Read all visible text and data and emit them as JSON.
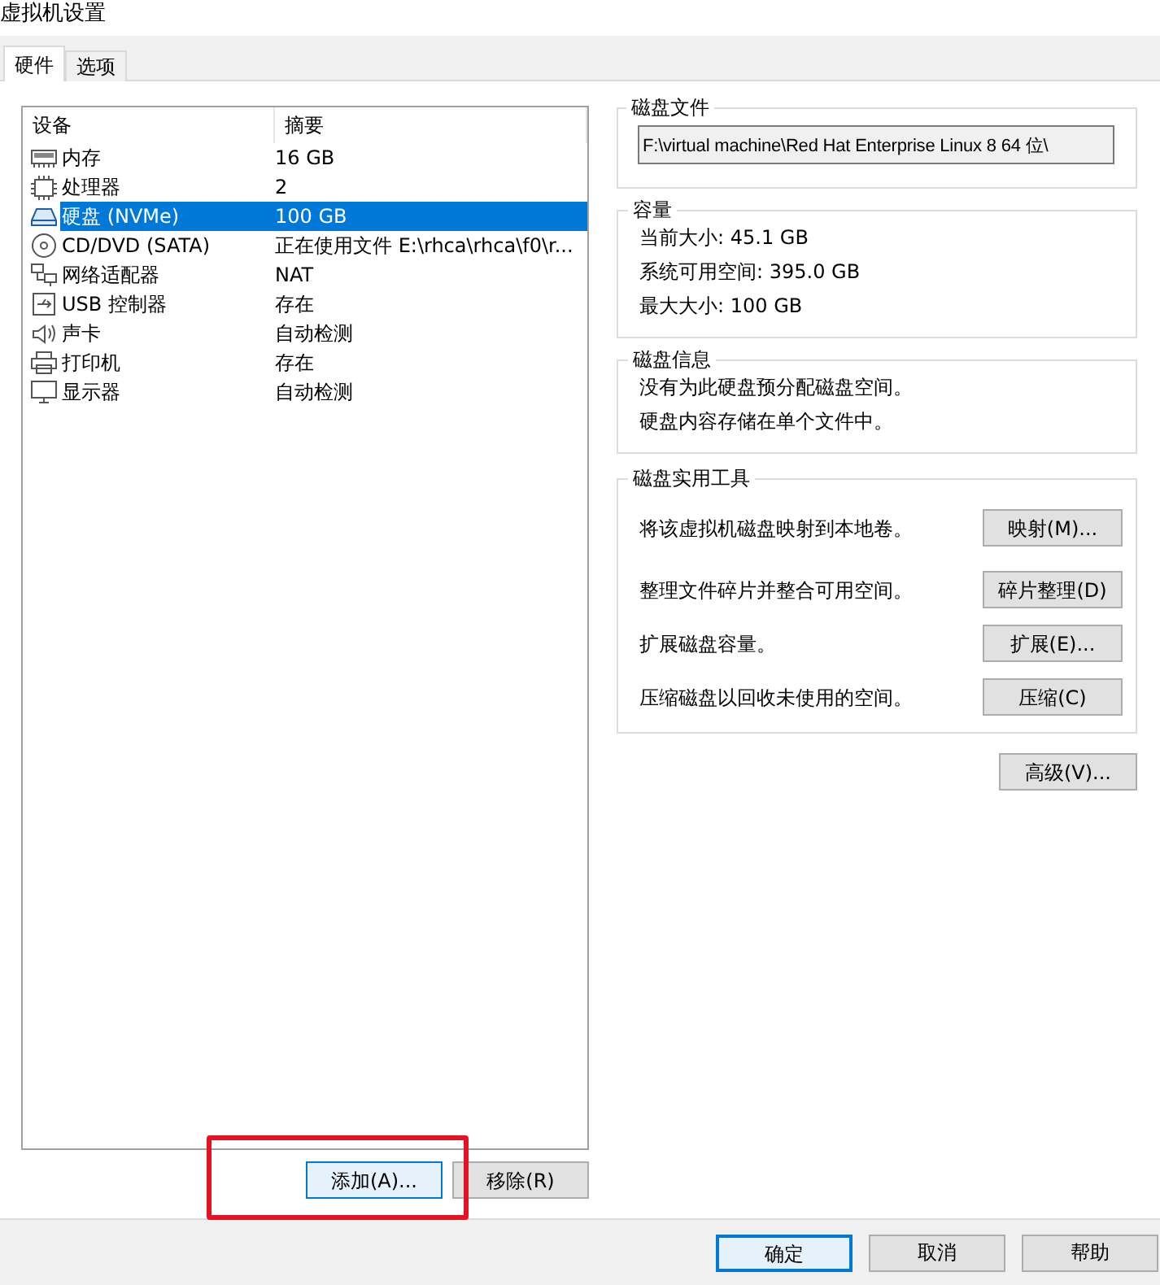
{
  "window": {
    "title": "虚拟机设置"
  },
  "tabs": [
    {
      "label": "硬件",
      "selected": true
    },
    {
      "label": "选项",
      "selected": false
    }
  ],
  "device_list": {
    "columns": [
      "设备",
      "摘要"
    ],
    "rows": [
      {
        "kind": "memory",
        "device": "内存",
        "summary": "16 GB",
        "selected": false
      },
      {
        "kind": "cpu",
        "device": "处理器",
        "summary": "2",
        "selected": false
      },
      {
        "kind": "disk",
        "device": "硬盘 (NVMe)",
        "summary": "100 GB",
        "selected": true
      },
      {
        "kind": "cdrom",
        "device": "CD/DVD (SATA)",
        "summary": "正在使用文件 E:\\rhca\\rhca\\f0\\r...",
        "selected": false
      },
      {
        "kind": "network",
        "device": "网络适配器",
        "summary": "NAT",
        "selected": false
      },
      {
        "kind": "usb",
        "device": "USB 控制器",
        "summary": "存在",
        "selected": false
      },
      {
        "kind": "sound",
        "device": "声卡",
        "summary": "自动检测",
        "selected": false
      },
      {
        "kind": "printer",
        "device": "打印机",
        "summary": "存在",
        "selected": false
      },
      {
        "kind": "display",
        "device": "显示器",
        "summary": "自动检测",
        "selected": false
      }
    ]
  },
  "list_buttons": [
    {
      "label": "添加(A)...",
      "focused": true
    },
    {
      "label": "移除(R)",
      "focused": false
    }
  ],
  "disk_file": {
    "title": "磁盘文件",
    "value": "F:\\virtual machine\\Red Hat Enterprise Linux 8 64 位\\"
  },
  "capacity": {
    "title": "容量",
    "lines": [
      "当前大小: 45.1 GB",
      "系统可用空间: 395.0 GB",
      "最大大小: 100 GB"
    ]
  },
  "disk_info": {
    "title": "磁盘信息",
    "lines": [
      "没有为此硬盘预分配磁盘空间。",
      "硬盘内容存储在单个文件中。"
    ]
  },
  "disk_utilities": {
    "title": "磁盘实用工具",
    "rows": [
      {
        "description": "将该虚拟机磁盘映射到本地卷。",
        "button": "映射(M)..."
      },
      {
        "description": "整理文件碎片并整合可用空间。",
        "button": "碎片整理(D)"
      },
      {
        "description": "扩展磁盘容量。",
        "button": "扩展(E)..."
      },
      {
        "description": "压缩磁盘以回收未使用的空间。",
        "button": "压缩(C)"
      }
    ]
  },
  "advanced_button": "高级(V)...",
  "footer_buttons": [
    {
      "label": "确定",
      "focused": true
    },
    {
      "label": "取消",
      "focused": false
    },
    {
      "label": "帮助",
      "focused": false
    }
  ]
}
